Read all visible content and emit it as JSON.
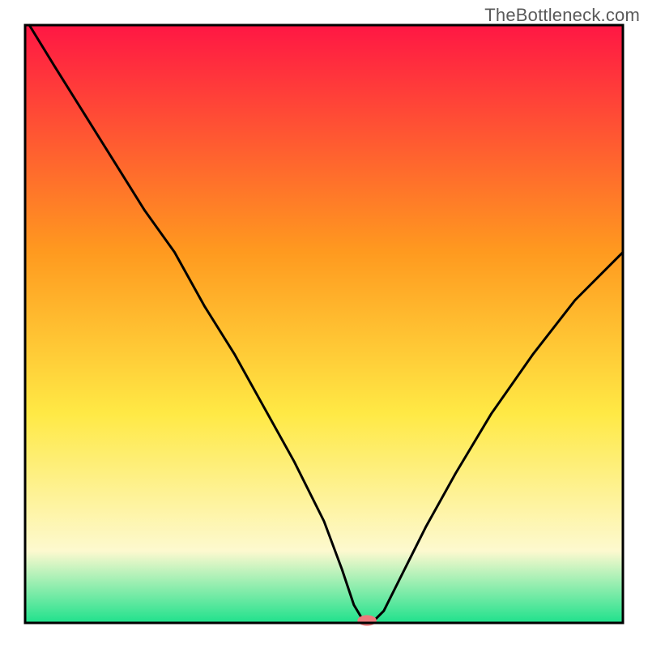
{
  "watermark": "TheBottleneck.com",
  "colors": {
    "top_red": "#ff1744",
    "orange": "#ff9a1f",
    "yellow": "#ffe945",
    "pale_yellow": "#fdf9cf",
    "green": "#1fe18c",
    "marker": "#ec7a7c",
    "curve": "#000000",
    "frame": "#000000"
  },
  "chart_data": {
    "type": "line",
    "title": "",
    "xlabel": "",
    "ylabel": "",
    "xlim": [
      0,
      100
    ],
    "ylim": [
      0,
      100
    ],
    "legend": false,
    "grid": false,
    "background": "rainbow-vertical-gradient",
    "series": [
      {
        "name": "bottleneck-curve",
        "x": [
          0.7,
          5,
          10,
          15,
          20,
          25,
          30,
          35,
          40,
          45,
          50,
          53,
          55,
          56.5,
          58.5,
          60,
          63,
          67,
          72,
          78,
          85,
          92,
          100
        ],
        "y": [
          100,
          93,
          85,
          77,
          69,
          62,
          53,
          45,
          36,
          27,
          17,
          9,
          3,
          0.5,
          0.5,
          2,
          8,
          16,
          25,
          35,
          45,
          54,
          62
        ]
      }
    ],
    "marker": {
      "x": 57.2,
      "y": 0.4,
      "rx": 1.6,
      "ry": 0.9
    },
    "annotations": []
  }
}
